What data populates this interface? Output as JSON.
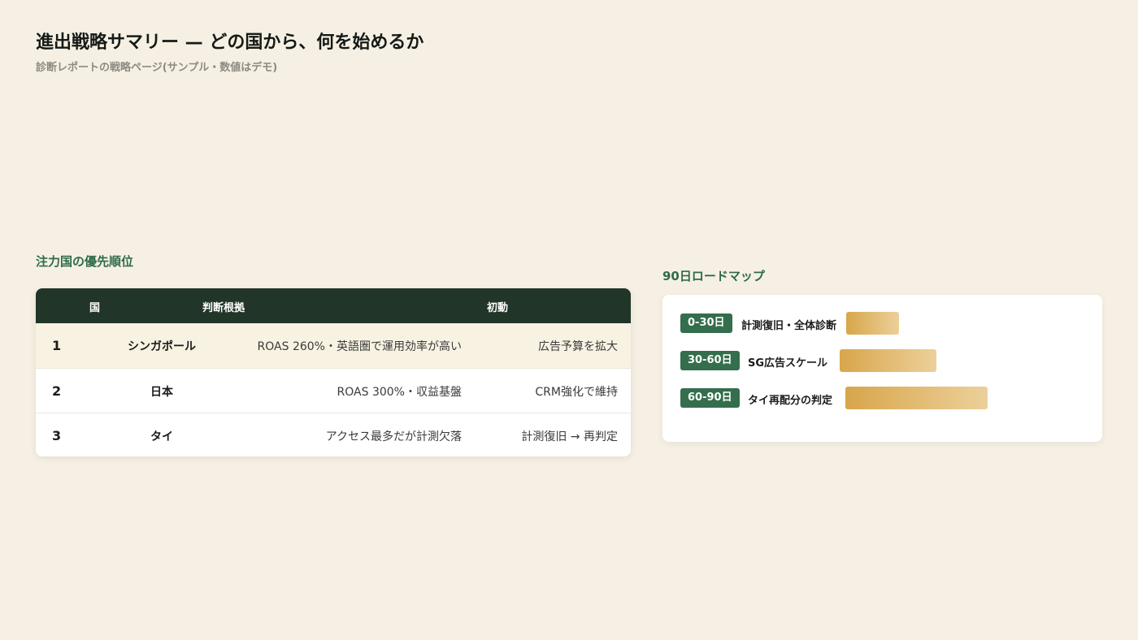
{
  "header": {
    "title": "進出戦略サマリー — どの国から、何を始めるか",
    "subtitle": "診断レポートの戦略ページ(サンプル・数値はデモ)"
  },
  "priority": {
    "title": "注力国の優先順位",
    "columns": [
      "国",
      "判断根拠",
      "初動"
    ],
    "rows": [
      {
        "rank": "1",
        "country": "シンガポール",
        "basis": "ROAS 260%・英語圏で運用効率が高い",
        "action": "広告予算を拡大"
      },
      {
        "rank": "2",
        "country": "日本",
        "basis": "ROAS 300%・収益基盤",
        "action": "CRM強化で維持"
      },
      {
        "rank": "3",
        "country": "タイ",
        "basis": "アクセス最多だが計測欠落",
        "action": "計測復旧 → 再判定"
      }
    ]
  },
  "roadmap": {
    "title": "90日ロードマップ",
    "items": [
      {
        "period": "0-30日",
        "label": "計測復旧・全体診断",
        "level": 0.37
      },
      {
        "period": "30-60日",
        "label": "SG広告スケール",
        "level": 0.68
      },
      {
        "period": "60-90日",
        "label": "タイ再配分の判定",
        "level": 1.0
      }
    ]
  },
  "colors": {
    "background": "#f6f0e4",
    "header_dark": "#213629",
    "accent_green": "#2f6b48",
    "badge_green": "#346e4c",
    "bar_gold_start": "#d8a64b",
    "bar_gold_end": "#ecd09a"
  }
}
